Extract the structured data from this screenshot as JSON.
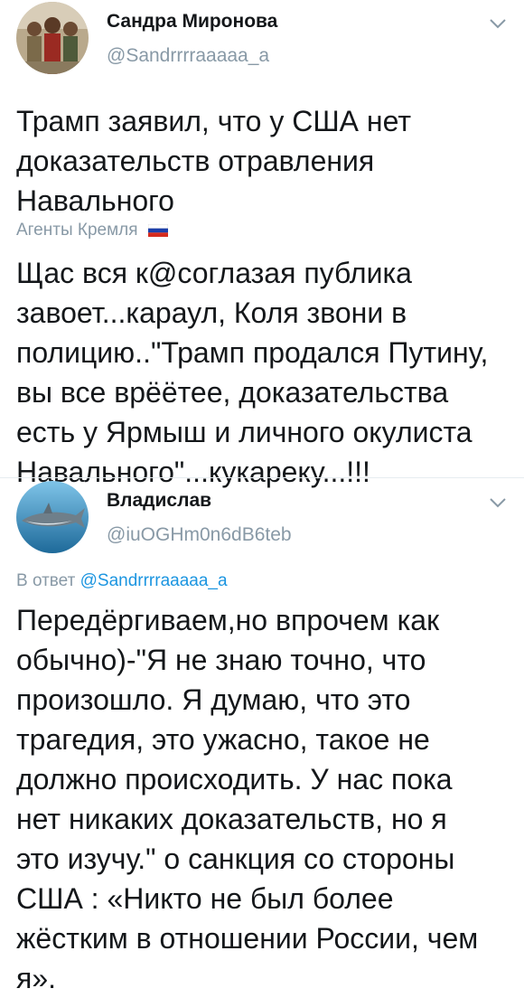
{
  "tweets": [
    {
      "author_name": "Сандра Миронова",
      "author_handle": "@Sandrrrraaaaa_a",
      "text": "Трамп заявил, что у США нет\nдоказательств отравления\nНавального",
      "menu_icon": "chevron-down-icon"
    },
    {
      "context_label": "Агенты Кремля",
      "context_icon": "russian-flag-icon",
      "text": "Щас вся к@соглазая публика\nзавоет...караул, Коля звони в\nполицию..\"Трамп продался Путину,\nвы все врёётее, доказательства\nесть у Ярмыш и личного окулиста\nНавального\"...кукареку...!!!"
    },
    {
      "author_name": "Владислав",
      "author_handle": "@iuOGHm0n6dB6teb",
      "reply_prefix": "В ответ",
      "reply_to": "@Sandrrrraaaaa_a",
      "text": "Передёргиваем,но впрочем как\nобычно)-\"Я не знаю точно, что\nпроизошло. Я думаю, что это\nтрагедия, это ужасно, такое не\nдолжно происходить. У нас пока\nнет никаких доказательств, но я\nэто изучу.\" о санкция со стороны\nСША : «Никто не был более\nжёстким в отношении России, чем\nя».",
      "menu_icon": "chevron-down-icon"
    }
  ],
  "colors": {
    "text": "#14171a",
    "secondary": "#8899a6",
    "link": "#1b95e0"
  }
}
